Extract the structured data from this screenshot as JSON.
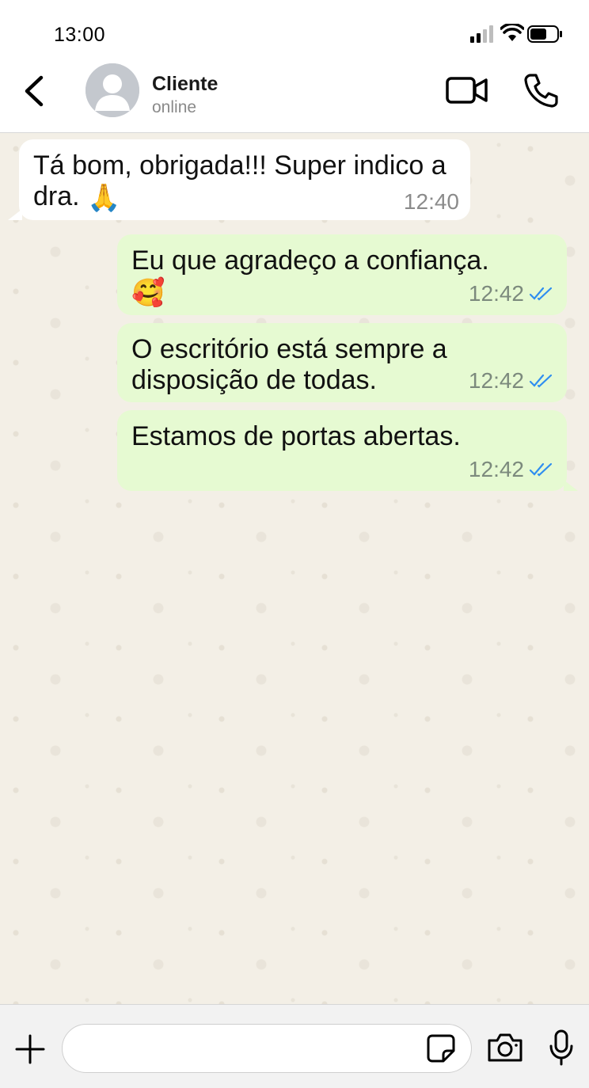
{
  "status_bar": {
    "time": "13:00"
  },
  "header": {
    "contact_name": "Cliente",
    "contact_status": "online"
  },
  "messages": [
    {
      "direction": "incoming",
      "text": "Tá bom, obrigada!!! Super indico a dra.",
      "emoji": "🙏",
      "time": "12:40"
    },
    {
      "direction": "outgoing",
      "text": "Eu que agradeço a confiança.",
      "emoji": "🥰",
      "time": "12:42",
      "status": "read"
    },
    {
      "direction": "outgoing",
      "text": "O escritório está sempre a disposição de todas.",
      "time": "12:42",
      "status": "read"
    },
    {
      "direction": "outgoing",
      "text": "Estamos de portas abertas.",
      "time": "12:42",
      "status": "read"
    }
  ],
  "input_bar": {
    "placeholder": "",
    "value": ""
  },
  "colors": {
    "outgoing_bubble": "#e6fad2",
    "incoming_bubble": "#ffffff",
    "read_ticks": "#2f8ef0",
    "chat_background": "#f3efe6"
  },
  "icons": {
    "back": "chevron-left-icon",
    "video": "video-camera-icon",
    "voice": "phone-icon",
    "plus": "plus-icon",
    "sticker": "sticker-icon",
    "camera": "camera-icon",
    "mic": "microphone-icon"
  }
}
